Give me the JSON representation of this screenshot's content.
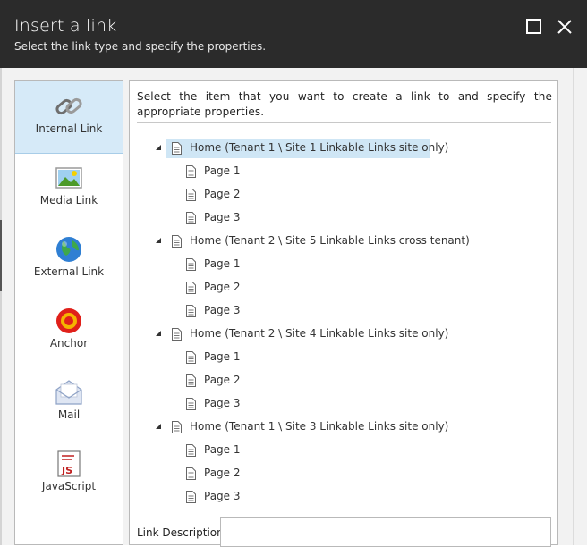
{
  "dialog": {
    "title": "Insert a link",
    "subtitle": "Select the link type and specify the properties."
  },
  "sidebar": {
    "items": [
      {
        "label": "Internal Link",
        "icon": "chain-link-icon",
        "active": true
      },
      {
        "label": "Media Link",
        "icon": "image-icon",
        "active": false
      },
      {
        "label": "External Link",
        "icon": "globe-icon",
        "active": false
      },
      {
        "label": "Anchor",
        "icon": "anchor-target-icon",
        "active": false
      },
      {
        "label": "Mail",
        "icon": "envelope-icon",
        "active": false
      },
      {
        "label": "JavaScript",
        "icon": "javascript-file-icon",
        "active": false
      }
    ]
  },
  "main": {
    "instruction": "Select the item that you want to create a link to and specify the appropriate properties.",
    "tree": [
      {
        "label": "Home (Tenant 1 \\ Site 1 Linkable Links site only)",
        "selected": true,
        "children": [
          "Page 1",
          "Page 2",
          "Page 3"
        ]
      },
      {
        "label": "Home (Tenant 2 \\ Site 5 Linkable Links cross tenant)",
        "selected": false,
        "children": [
          "Page 1",
          "Page 2",
          "Page 3"
        ]
      },
      {
        "label": "Home (Tenant 2 \\ Site 4 Linkable Links site only)",
        "selected": false,
        "children": [
          "Page 1",
          "Page 2",
          "Page 3"
        ]
      },
      {
        "label": "Home (Tenant 1 \\ Site 3 Linkable Links site only)",
        "selected": false,
        "children": [
          "Page 1",
          "Page 2",
          "Page 3"
        ]
      }
    ],
    "link_description_label": "Link Description:",
    "link_description_value": ""
  },
  "colors": {
    "titlebar": "#2b2b2b",
    "selection": "#cfe6f5",
    "sidebar_active": "#d6eaf8"
  }
}
